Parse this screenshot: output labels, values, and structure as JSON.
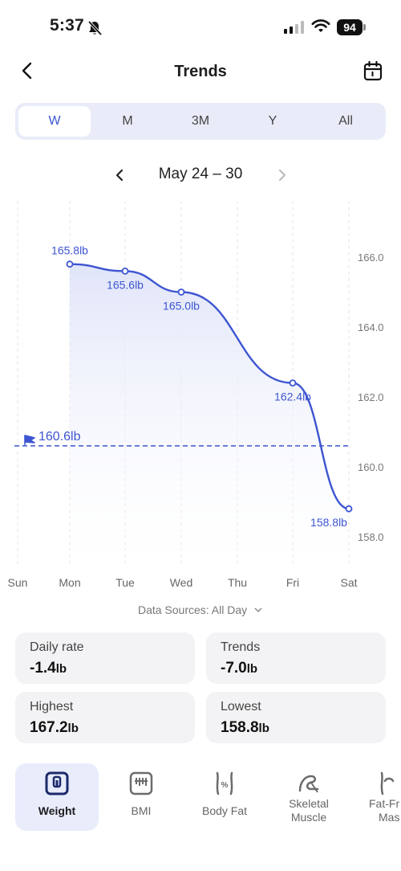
{
  "status_bar": {
    "time": "5:37",
    "battery": "94"
  },
  "header": {
    "title": "Trends"
  },
  "segments": [
    {
      "label": "W",
      "active": true
    },
    {
      "label": "M",
      "active": false
    },
    {
      "label": "3M",
      "active": false
    },
    {
      "label": "Y",
      "active": false
    },
    {
      "label": "All",
      "active": false
    }
  ],
  "date_nav": {
    "range": "May 24 – 30"
  },
  "chart_data": {
    "type": "line",
    "categories": [
      "Sun",
      "Mon",
      "Tue",
      "Wed",
      "Thu",
      "Fri",
      "Sat"
    ],
    "series": [
      {
        "values": [
          null,
          165.8,
          165.6,
          165.0,
          null,
          162.4,
          158.8
        ]
      }
    ],
    "data_labels": [
      "165.8lb",
      "165.6lb",
      "165.0lb",
      "162.4lb",
      "158.8lb"
    ],
    "y_ticks": [
      "166.0",
      "164.0",
      "162.0",
      "160.0",
      "158.0"
    ],
    "ylim": [
      158.0,
      166.0
    ],
    "goal": {
      "value": 160.6,
      "label": "160.6lb"
    },
    "axis_side": "right",
    "accent_color": "#3d55d1"
  },
  "data_sources": "Data Sources: All Day",
  "stats": {
    "daily_rate": {
      "label": "Daily rate",
      "value": "-1.4",
      "unit": "lb"
    },
    "trends": {
      "label": "Trends",
      "value": "-7.0",
      "unit": "lb"
    },
    "highest": {
      "label": "Highest",
      "value": "167.2",
      "unit": "lb"
    },
    "lowest": {
      "label": "Lowest",
      "value": "158.8",
      "unit": "lb"
    }
  },
  "metrics": [
    {
      "label": "Weight",
      "icon": "scale-icon",
      "active": true
    },
    {
      "label": "BMI",
      "icon": "bmi-gauge-icon",
      "active": false
    },
    {
      "label": "Body Fat",
      "icon": "body-fat-icon",
      "active": false
    },
    {
      "label": "Skeletal Muscle",
      "line1": "Skeletal",
      "line2": "Muscle",
      "icon": "muscle-icon",
      "active": false
    },
    {
      "label": "Fat-Free Mass",
      "line1": "Fat-Fr",
      "line2": "Mas",
      "icon": "fat-free-mass-icon",
      "active": false
    }
  ]
}
